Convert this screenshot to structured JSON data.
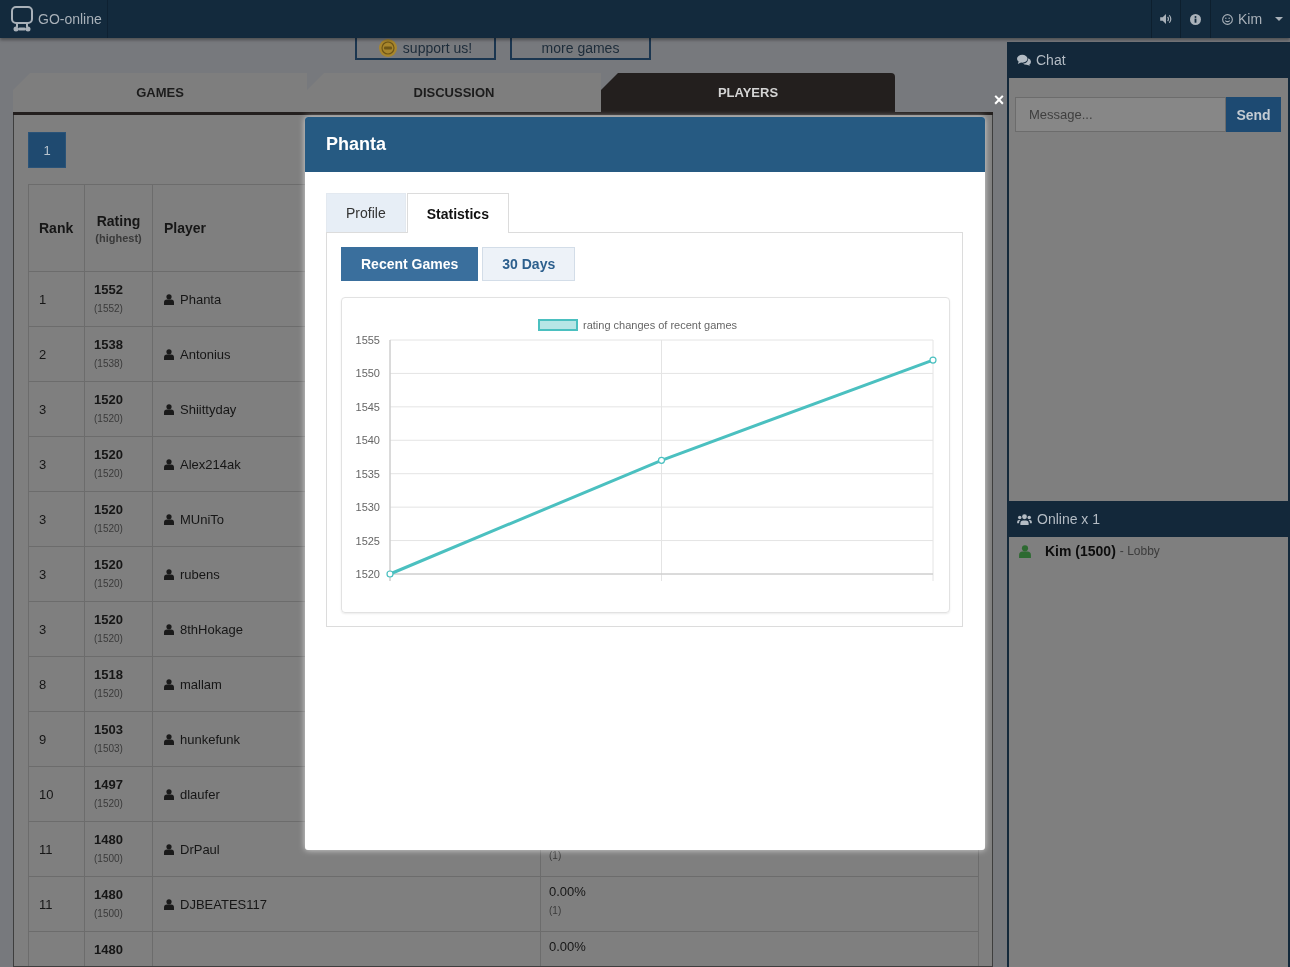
{
  "top_bar": {
    "logo": "GO-online",
    "user": "Kim"
  },
  "links": [
    {
      "label": "support us!",
      "kind": "support"
    },
    {
      "label": "more games",
      "kind": "plain"
    }
  ],
  "page_tabs": [
    {
      "label": "GAMES",
      "selected": false
    },
    {
      "label": "DISCUSSION",
      "selected": false
    },
    {
      "label": "PLAYERS",
      "selected": true
    }
  ],
  "pagination": [
    {
      "label": "1",
      "selected": true
    }
  ],
  "players_table": {
    "columns": [
      {
        "label": "Rank"
      },
      {
        "label": "Rating",
        "sub": "(highest)"
      },
      {
        "label": "Player"
      }
    ],
    "rows": [
      {
        "rank": "1",
        "rating": "1552",
        "highest": "(1552)",
        "player": "Phanta"
      },
      {
        "rank": "2",
        "rating": "1538",
        "highest": "(1538)",
        "player": "Antonius"
      },
      {
        "rank": "3",
        "rating": "1520",
        "highest": "(1520)",
        "player": "Shiittyday"
      },
      {
        "rank": "3",
        "rating": "1520",
        "highest": "(1520)",
        "player": "Alex214ak"
      },
      {
        "rank": "3",
        "rating": "1520",
        "highest": "(1520)",
        "player": "MUniTo"
      },
      {
        "rank": "3",
        "rating": "1520",
        "highest": "(1520)",
        "player": "rubens"
      },
      {
        "rank": "3",
        "rating": "1520",
        "highest": "(1520)",
        "player": "8thHokage"
      },
      {
        "rank": "8",
        "rating": "1518",
        "highest": "(1520)",
        "player": "mallam"
      },
      {
        "rank": "9",
        "rating": "1503",
        "highest": "(1503)",
        "player": "hunkefunk"
      },
      {
        "rank": "10",
        "rating": "1497",
        "highest": "(1520)",
        "player": "dlaufer"
      },
      {
        "rank": "11",
        "rating": "1480",
        "highest": "(1500)",
        "player": "DrPaul",
        "games": "(1)"
      },
      {
        "rank": "11",
        "rating": "1480",
        "highest": "(1500)",
        "player": "DJBEATES117",
        "win_rate": "0.00%",
        "games": "(1)"
      },
      {
        "rating": "1480",
        "win_rate": "0.00%"
      }
    ]
  },
  "modal": {
    "title": "Phanta",
    "close": "×",
    "tabs": [
      {
        "label": "Profile",
        "selected": false
      },
      {
        "label": "Statistics",
        "selected": true
      }
    ],
    "views": [
      {
        "label": "Recent Games",
        "selected": true
      },
      {
        "label": "30 Days",
        "selected": false
      }
    ],
    "chart_data": [
      {
        "type": "line",
        "categories": [
          null,
          null,
          null
        ],
        "series": [
          {
            "name": "rating changes of recent games",
            "color": "#4bc0c0",
            "values": [
              1520,
              1537,
              1552
            ]
          }
        ],
        "ylim": [
          1520,
          1555
        ],
        "yticks": [
          1520,
          1525,
          1530,
          1535,
          1540,
          1545,
          1550,
          1555
        ],
        "legend": "top",
        "grid": true,
        "marker": "circle"
      }
    ]
  },
  "chat": {
    "title": "Chat",
    "placeholder": "Message...",
    "send": "Send"
  },
  "online": {
    "title": "Online x 1",
    "users": [
      {
        "name": "Kim (1500)",
        "location": "- Lobby"
      }
    ]
  }
}
